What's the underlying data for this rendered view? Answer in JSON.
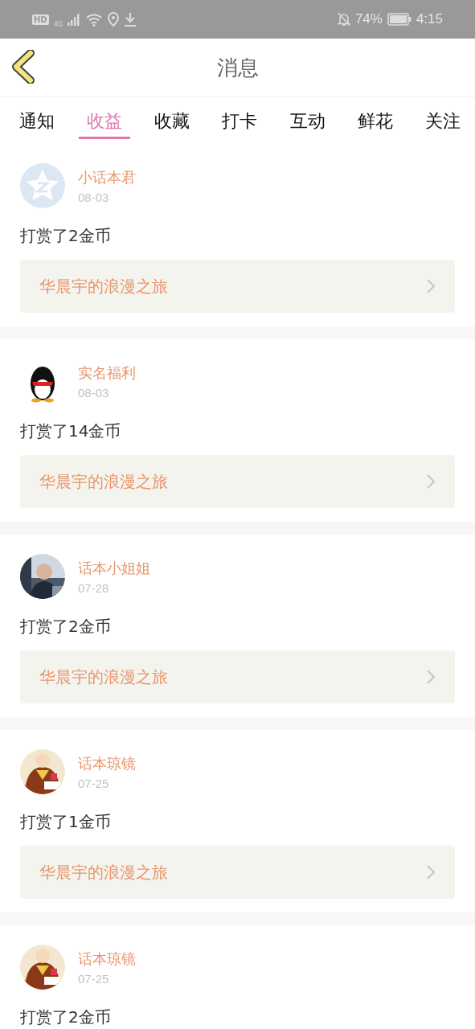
{
  "status_bar": {
    "hd": "HD",
    "network": "4G",
    "battery": "74%",
    "time": "4:15"
  },
  "header": {
    "title": "消息"
  },
  "tabs": [
    {
      "label": "通知",
      "selected": false
    },
    {
      "label": "收益",
      "selected": true
    },
    {
      "label": "收藏",
      "selected": false
    },
    {
      "label": "打卡",
      "selected": false
    },
    {
      "label": "互动",
      "selected": false
    },
    {
      "label": "鲜花",
      "selected": false
    },
    {
      "label": "关注",
      "selected": false
    }
  ],
  "items": [
    {
      "avatar": {
        "kind": "star"
      },
      "name": "小话本君",
      "date": "08-03",
      "message": "打赏了2金币",
      "book": "华晨宇的浪漫之旅"
    },
    {
      "avatar": {
        "kind": "mascot"
      },
      "name": "实名福利",
      "date": "08-03",
      "message": "打赏了14金币",
      "book": "华晨宇的浪漫之旅"
    },
    {
      "name": "话本小姐姐",
      "date": "07-28",
      "message": "打赏了2金币",
      "book": "华晨宇的浪漫之旅"
    },
    {
      "avatar": {
        "kind": "illustration"
      },
      "name": "话本琼镜",
      "date": "07-25",
      "message": "打赏了1金币",
      "book": "华晨宇的浪漫之旅"
    },
    {
      "avatar": {
        "kind": "illustration"
      },
      "name": "话本琼镜",
      "date": "07-25",
      "message": "打赏了2金币"
    }
  ]
}
